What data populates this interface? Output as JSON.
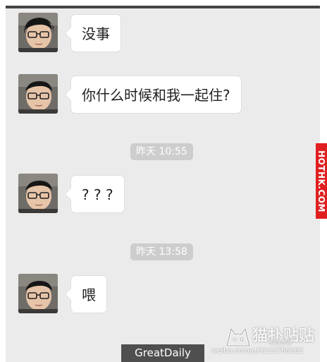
{
  "messages": [
    {
      "type": "message",
      "text": "没事"
    },
    {
      "type": "message",
      "text": "你什么时候和我一起住?"
    },
    {
      "type": "timestamp",
      "text": "昨天 10:55"
    },
    {
      "type": "message",
      "text": "? ? ?"
    },
    {
      "type": "timestamp",
      "text": "昨天 13:58"
    },
    {
      "type": "message",
      "text": "喂"
    }
  ],
  "side_banner": "HOTHK.COM",
  "bottom_label": "GreatDaily",
  "watermark": {
    "brand": "猫扑贴贴",
    "small": "新浪微博",
    "url": "weibo.com/u/3232756282"
  },
  "colors": {
    "chat_background": "#ebebeb",
    "bubble": "#ffffff",
    "timestamp_pill": "#cdcdcd",
    "banner": "#e02020",
    "bottom_label": "#4f4f4f"
  }
}
